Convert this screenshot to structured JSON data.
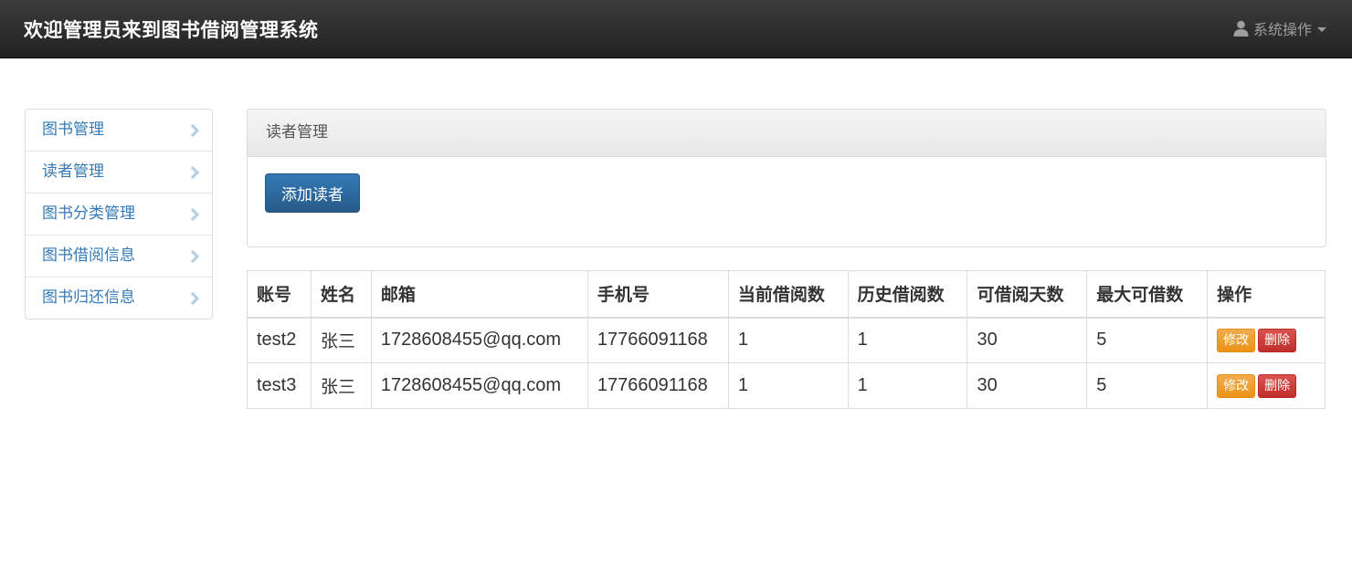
{
  "navbar": {
    "brand": "欢迎管理员来到图书借阅管理系统",
    "system_menu_label": "系统操作",
    "system_menu_icon": "user-icon"
  },
  "sidebar": {
    "items": [
      {
        "label": "图书管理"
      },
      {
        "label": "读者管理"
      },
      {
        "label": "图书分类管理"
      },
      {
        "label": "图书借阅信息"
      },
      {
        "label": "图书归还信息"
      }
    ]
  },
  "panel": {
    "heading": "读者管理",
    "add_button_label": "添加读者"
  },
  "table": {
    "columns": [
      "账号",
      "姓名",
      "邮箱",
      "手机号",
      "当前借阅数",
      "历史借阅数",
      "可借阅天数",
      "最大可借数",
      "操作"
    ],
    "rows": [
      {
        "account": "test2",
        "name": "张三",
        "email": "1728608455@qq.com",
        "phone": "17766091168",
        "current_borrows": "1",
        "history_borrows": "1",
        "borrow_days": "30",
        "max_borrows": "5"
      },
      {
        "account": "test3",
        "name": "张三",
        "email": "1728608455@qq.com",
        "phone": "17766091168",
        "current_borrows": "1",
        "history_borrows": "1",
        "borrow_days": "30",
        "max_borrows": "5"
      }
    ],
    "edit_label": "修改",
    "delete_label": "删除"
  },
  "colors": {
    "navbar_bg": "#222222",
    "link": "#337ab7",
    "primary": "#337ab7",
    "warning": "#f0ad4e",
    "danger": "#d9534f"
  }
}
